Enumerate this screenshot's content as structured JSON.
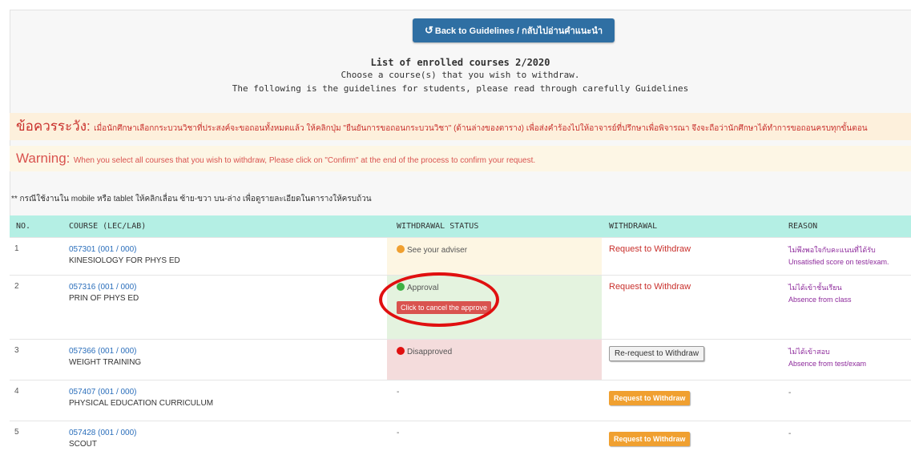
{
  "back_button": {
    "label": "Back to Guidelines / กลับไปอ่านคำแนะนำ",
    "icon": "undo-icon"
  },
  "header": {
    "title": "List of enrolled courses 2/2020",
    "subtitle": "Choose a course(s) that you wish to withdraw.",
    "guidelines": "The following is the guidelines for students, please read through carefully Guidelines"
  },
  "caution": {
    "big": "ข้อควรระวัง:",
    "text": "เมื่อนักศึกษาเลือกกระบวนวิชาที่ประสงค์จะขอถอนทั้งหมดแล้ว ให้คลิกปุ่ม \"ยืนยันการขอถอนกระบวนวิชา\" (ด้านล่างของตาราง) เพื่อส่งคำร้องไปให้อาจารย์ที่ปรึกษาเพื่อพิจารณา จึงจะถือว่านักศึกษาได้ทำการขอถอนครบทุกขั้นตอน"
  },
  "warning": {
    "big": "Warning:",
    "text": "When you select all courses that you wish to withdraw, Please click on \"Confirm\" at the end of the process to confirm your request."
  },
  "mobile_note": "** กรณีใช้งานใน mobile หรือ tablet ให้คลิกเลื่อน ซ้าย-ขวา บน-ล่าง เพื่อดูรายละเอียดในตารางให้ครบถ้วน",
  "table": {
    "headers": {
      "no": "NO.",
      "course": "COURSE (LEC/LAB)",
      "status": "WITHDRAWAL STATUS",
      "withdrawal": "WITHDRAWAL",
      "reason": "REASON"
    },
    "rows": [
      {
        "no": "1",
        "code": "057301 (001 / 000)",
        "name": "KINESIOLOGY FOR PHYS ED",
        "status": "See your adviser",
        "withdrawal": "Request to Withdraw",
        "reason_th": "ไม่พึงพอใจกับคะแนนที่ได้รับ",
        "reason_en": "Unsatisfied score on test/exam."
      },
      {
        "no": "2",
        "code": "057316 (001 / 000)",
        "name": "PRIN OF PHYS ED",
        "status": "Approval",
        "cancel_label": "Click to cancel the approve",
        "withdrawal": "Request to Withdraw",
        "reason_th": "ไม่ได้เข้าชั้นเรียน",
        "reason_en": "Absence from class"
      },
      {
        "no": "3",
        "code": "057366 (001 / 000)",
        "name": "WEIGHT TRAINING",
        "status": "Disapproved",
        "withdrawal": "Re-request to Withdraw",
        "reason_th": "ไม่ได้เข้าสอบ",
        "reason_en": "Absence from test/exam"
      },
      {
        "no": "4",
        "code": "057407 (001 / 000)",
        "name": "PHYSICAL EDUCATION CURRICULUM",
        "status": "-",
        "withdrawal": "Request to Withdraw",
        "reason": "-"
      },
      {
        "no": "5",
        "code": "057428 (001 / 000)",
        "name": "SCOUT",
        "status": "-",
        "withdrawal": "Request to Withdraw",
        "reason": "-"
      }
    ]
  },
  "colors": {
    "accent": "#2f6fa3",
    "danger": "#d9534f",
    "orange": "#f0a030",
    "status_yellow": "#f0a030",
    "status_green": "#3cb043",
    "status_red": "#e01010"
  }
}
